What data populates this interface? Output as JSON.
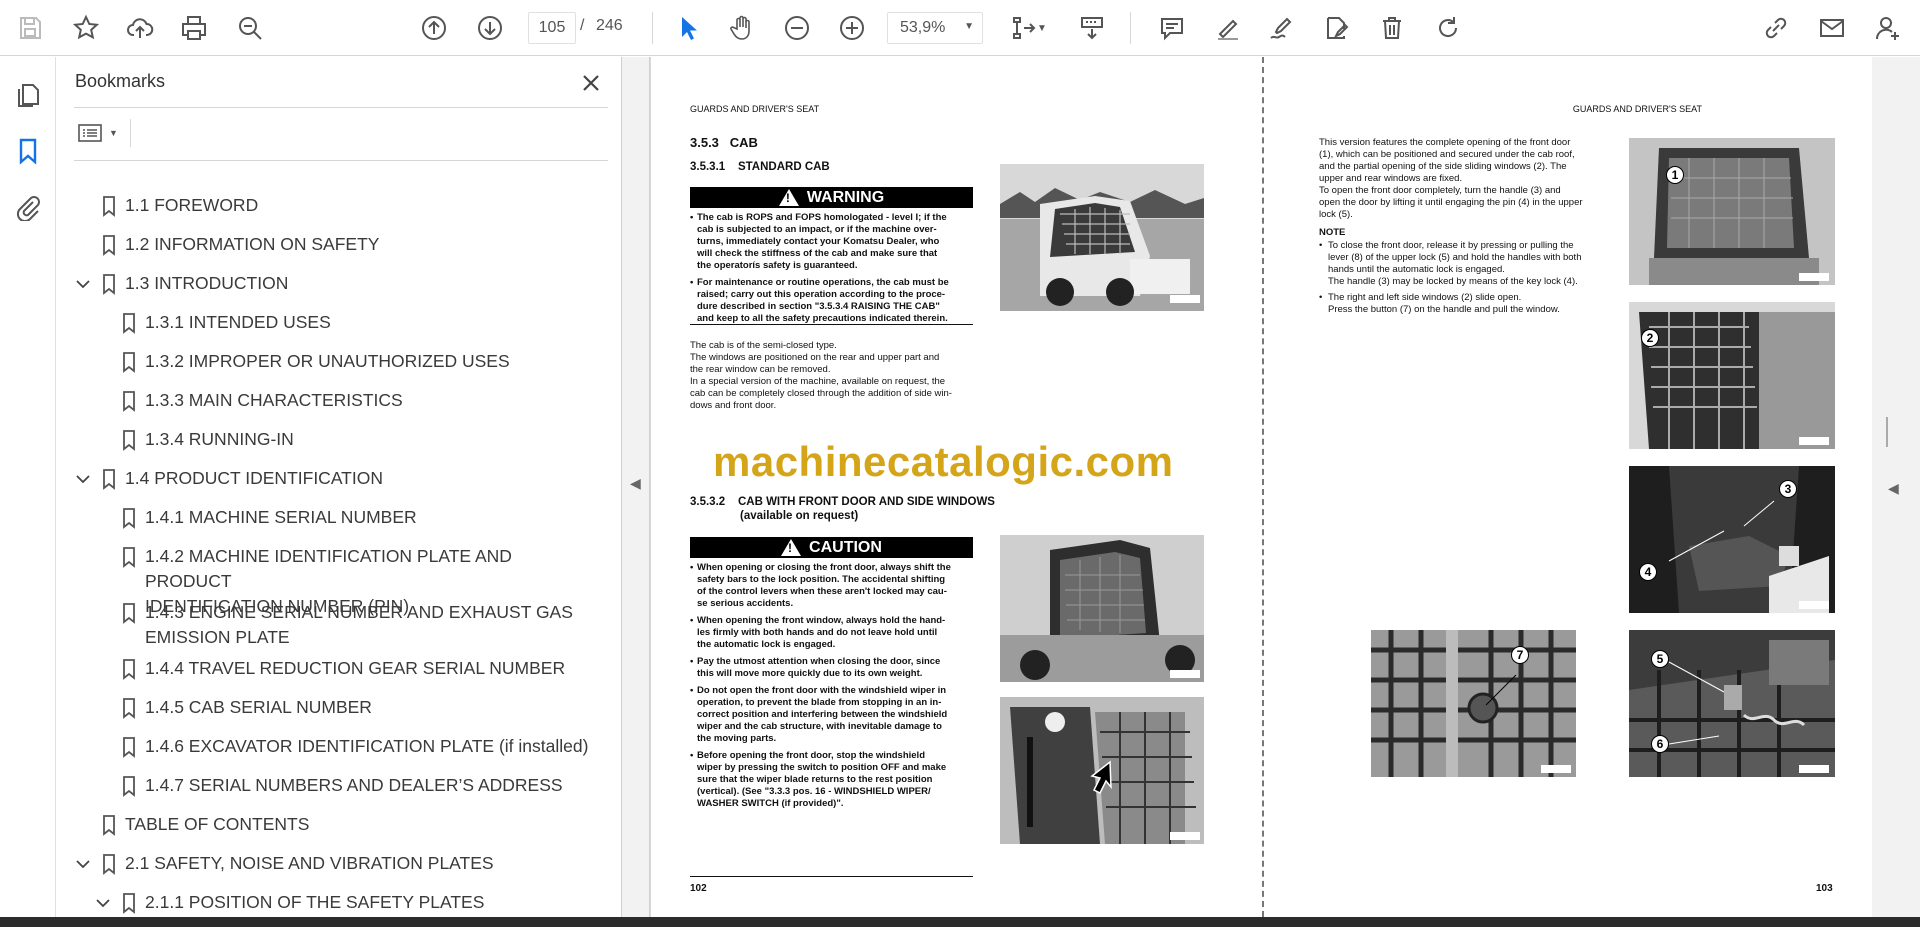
{
  "toolbar": {
    "page_current": "105",
    "page_separator": "/",
    "page_total": "246",
    "zoom": "53,9%"
  },
  "bookmarks_panel": {
    "title": "Bookmarks",
    "items": [
      {
        "label": "1.1 FOREWORD",
        "level": 0,
        "expanded": null
      },
      {
        "label": "1.2 INFORMATION ON SAFETY",
        "level": 0,
        "expanded": null
      },
      {
        "label": "1.3 INTRODUCTION",
        "level": 0,
        "expanded": true
      },
      {
        "label": "1.3.1 INTENDED USES",
        "level": 1,
        "expanded": null
      },
      {
        "label": "1.3.2 IMPROPER OR UNAUTHORIZED USES",
        "level": 1,
        "expanded": null
      },
      {
        "label": "1.3.3 MAIN CHARACTERISTICS",
        "level": 1,
        "expanded": null
      },
      {
        "label": "1.3.4 RUNNING-IN",
        "level": 1,
        "expanded": null
      },
      {
        "label": "1.4 PRODUCT IDENTIFICATION",
        "level": 0,
        "expanded": true
      },
      {
        "label": "1.4.1 MACHINE SERIAL NUMBER",
        "level": 1,
        "expanded": null
      },
      {
        "label": "1.4.2 MACHINE IDENTIFICATION PLATE AND PRODUCT",
        "label2": "IDENTIFICATION NUMBER (PIN)",
        "level": 1,
        "expanded": null
      },
      {
        "label": "1.4.3 ENGINE SERIAL NUMBER AND EXHAUST GAS",
        "label2": "EMISSION PLATE",
        "level": 1,
        "expanded": null
      },
      {
        "label": "1.4.4 TRAVEL REDUCTION GEAR SERIAL NUMBER",
        "level": 1,
        "expanded": null
      },
      {
        "label": "1.4.5 CAB SERIAL NUMBER",
        "level": 1,
        "expanded": null
      },
      {
        "label": "1.4.6 EXCAVATOR IDENTIFICATION PLATE (if installed)",
        "level": 1,
        "expanded": null
      },
      {
        "label": "1.4.7 SERIAL NUMBERS AND DEALER’S ADDRESS",
        "level": 1,
        "expanded": null
      },
      {
        "label": "TABLE OF CONTENTS",
        "level": 0,
        "expanded": null
      },
      {
        "label": "2.1 SAFETY, NOISE AND VIBRATION PLATES",
        "level": 0,
        "expanded": true
      },
      {
        "label": "2.1.1 POSITION OF THE SAFETY PLATES",
        "level": 1,
        "expanded": true
      }
    ]
  },
  "document": {
    "left_page": {
      "header": "GUARDS AND DRIVER'S SEAT",
      "section_num": "3.5.3",
      "section_title": "CAB",
      "sub1_num": "3.5.3.1",
      "sub1_title": "STANDARD CAB",
      "warning_label": "WARNING",
      "warning_bullets": [
        [
          "The cab is ROPS and FOPS homologated - level I; if the",
          "cab is subjected to an impact, or if the machine over-",
          "turns, immediately contact your Komatsu Dealer, who",
          "will check the stiffness of the cab and make sure that",
          "the operatorís safety is guaranteed."
        ],
        [
          "For maintenance or routine operations, the cab must be",
          "raised; carry out this operation according to the proce-",
          "dure described in section \"3.5.3.4 RAISING THE CAB\"",
          "and keep to all the safety precautions indicated therein."
        ]
      ],
      "body": [
        "The cab is of the semi-closed type.",
        "The windows are positioned on the rear and upper part and",
        "the rear window can be removed.",
        "In a special version of the machine, available on request, the",
        "cab can be completely closed through the addition of side win-",
        "dows and front door."
      ],
      "sub2_num": "3.5.3.2",
      "sub2_title": "CAB WITH FRONT DOOR AND SIDE WINDOWS",
      "sub2_title2": "(available on request)",
      "caution_label": "CAUTION",
      "caution_bullets": [
        [
          "When opening or closing the front door, always shift the",
          "safety bars to the lock position. The accidental shifting",
          "of the control levers when these aren't locked may cau-",
          "se serious accidents."
        ],
        [
          "When opening the front window, always hold the hand-",
          "les firmly with both hands and do not leave hold until",
          "the automatic lock is engaged."
        ],
        [
          "Pay the utmost attention when closing the door, since",
          "this will move more quickly due to its own weight."
        ],
        [
          "Do not open the front door with the windshield wiper in",
          "operation, to prevent the blade from stopping in an in-",
          "correct position and interfering between the windshield",
          "wiper and the cab structure, with inevitable damage to",
          "the moving parts."
        ],
        [
          "Before opening the front door, stop the windshield",
          "wiper by pressing the switch to position OFF and make",
          "sure that the wiper blade returns to the rest position",
          "(vertical). (See \"3.3.3 pos.  16 - WINDSHIELD WIPER/",
          "WASHER SWITCH (if provided)\"."
        ]
      ],
      "page_number": "102",
      "photo_codes": [
        "RKA13330",
        "RKA82600",
        "RKA82610"
      ]
    },
    "right_page": {
      "header": "GUARDS AND DRIVER'S SEAT",
      "body": [
        "This version features the complete opening of the front door",
        "(1), which can be positioned and secured under the cab roof,",
        "and the partial opening of the side sliding windows (2). The",
        "upper and rear windows are fixed.",
        "To open the front door completely, turn the handle (3) and",
        "open the door by lifting it until engaging the pin (4) in the upper",
        "lock (5)."
      ],
      "note_label": "NOTE",
      "note_bullets": [
        [
          "To close the front door, release it by pressing or pulling the",
          "lever (8) of the upper lock (5) and hold the handles with both",
          "hands until the automatic lock is engaged.",
          "The handle (3) may be locked by means of the key lock (4)."
        ],
        [
          "The right and left side windows (2) slide open.",
          "Press the button (7) on the handle and pull the window."
        ]
      ],
      "page_number": "103",
      "callouts": [
        "1",
        "2",
        "3",
        "4",
        "5",
        "6",
        "7"
      ],
      "photo_codes": [
        "RKA82620",
        "RKA82630",
        "RKA82640",
        "RKA82660",
        "RKA82650"
      ]
    },
    "watermark": "machinecatalogic.com"
  }
}
